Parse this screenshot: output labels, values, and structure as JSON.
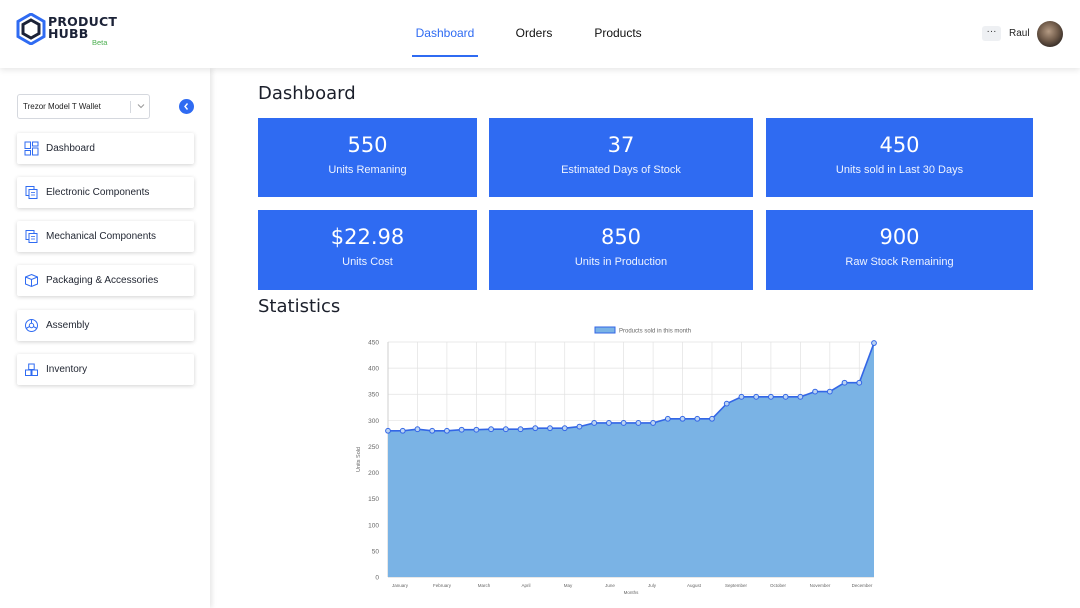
{
  "brand": {
    "name_line1": "PRODUCT",
    "name_line2": "HUBB",
    "badge": "Beta",
    "color": "#2f6bf2"
  },
  "nav": {
    "tabs": [
      {
        "label": "Dashboard",
        "active": true
      },
      {
        "label": "Orders",
        "active": false
      },
      {
        "label": "Products",
        "active": false
      }
    ]
  },
  "user": {
    "more_icon": "ellipsis-icon",
    "more_label": "···",
    "name": "Raul"
  },
  "sidebar": {
    "product_select": {
      "value": "Trezor Model T Wallet"
    },
    "items": [
      {
        "label": "Dashboard",
        "icon": "dashboard-icon"
      },
      {
        "label": "Electronic Components",
        "icon": "components-icon"
      },
      {
        "label": "Mechanical Components",
        "icon": "components-icon"
      },
      {
        "label": "Packaging & Accessories",
        "icon": "box-icon"
      },
      {
        "label": "Assembly",
        "icon": "assembly-icon"
      },
      {
        "label": "Inventory",
        "icon": "inventory-icon"
      }
    ]
  },
  "main": {
    "title": "Dashboard",
    "cards": [
      {
        "value": "550",
        "caption": "Units Remaning"
      },
      {
        "value": "37",
        "caption": "Estimated Days of Stock"
      },
      {
        "value": "450",
        "caption": "Units sold in Last 30 Days"
      },
      {
        "value": "$22.98",
        "caption": "Units Cost"
      },
      {
        "value": "850",
        "caption": "Units in Production"
      },
      {
        "value": "900",
        "caption": "Raw Stock Remaining"
      }
    ],
    "stats_title": "Statistics"
  },
  "chart_data": {
    "type": "area",
    "legend": "Products sold in this month",
    "legend_position": "top",
    "xlabel": "Months",
    "ylabel": "Units Sold",
    "ylim": [
      0,
      450
    ],
    "yticks": [
      0,
      50,
      100,
      150,
      200,
      250,
      300,
      350,
      400,
      450
    ],
    "grid": true,
    "month_labels": [
      "January",
      "February",
      "March",
      "April",
      "May",
      "June",
      "July",
      "August",
      "September",
      "October",
      "November",
      "December"
    ],
    "series": [
      {
        "name": "Products sold in this month",
        "values": [
          280,
          280,
          283,
          280,
          280,
          282,
          282,
          283,
          283,
          283,
          285,
          285,
          285,
          288,
          295,
          295,
          295,
          295,
          295,
          303,
          303,
          303,
          303,
          332,
          345,
          345,
          345,
          345,
          345,
          355,
          355,
          372,
          372,
          448
        ]
      }
    ],
    "colors": {
      "line": "#3366e6",
      "fill": "#7ab3e5",
      "point": "#3366e6",
      "grid": "#e2e2e2"
    }
  }
}
